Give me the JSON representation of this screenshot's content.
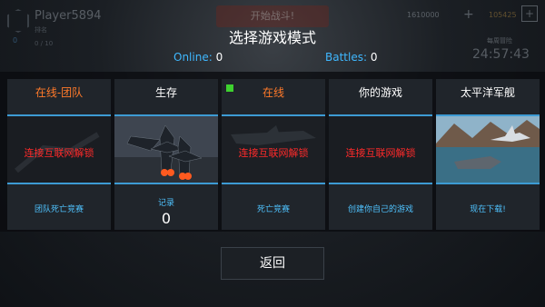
{
  "hud": {
    "player_name": "Player5894",
    "player_sub": "排名",
    "level": "0",
    "xp": "0 / 10",
    "start_battle": "开始战斗!",
    "currency_silver": "1610000",
    "currency_gold": "105425",
    "timer_label": "每周冒险",
    "timer": "24:57:43"
  },
  "header": {
    "title": "选择游戏模式",
    "online_label": "Online:",
    "online_value": "0",
    "battles_label": "Battles:",
    "battles_value": "0"
  },
  "modes": [
    {
      "title": "在线-团队",
      "locked_text": "连接互联网解锁",
      "footer": "团队死亡竞赛"
    },
    {
      "title": "生存",
      "record_label": "记录",
      "record_value": "0"
    },
    {
      "title": "在线",
      "locked_text": "连接互联网解锁",
      "footer": "死亡竞赛"
    },
    {
      "title": "你的游戏",
      "locked_text": "连接互联网解锁",
      "footer": "创建你自己的游戏"
    },
    {
      "title": "太平洋军舰",
      "footer": "现在下载!"
    }
  ],
  "back_label": "返回",
  "colors": {
    "accent_blue": "#4fc3ff",
    "lock_red": "#ff2a2a",
    "mode_orange": "#ff7a2a",
    "online_green": "#3ed12f"
  }
}
